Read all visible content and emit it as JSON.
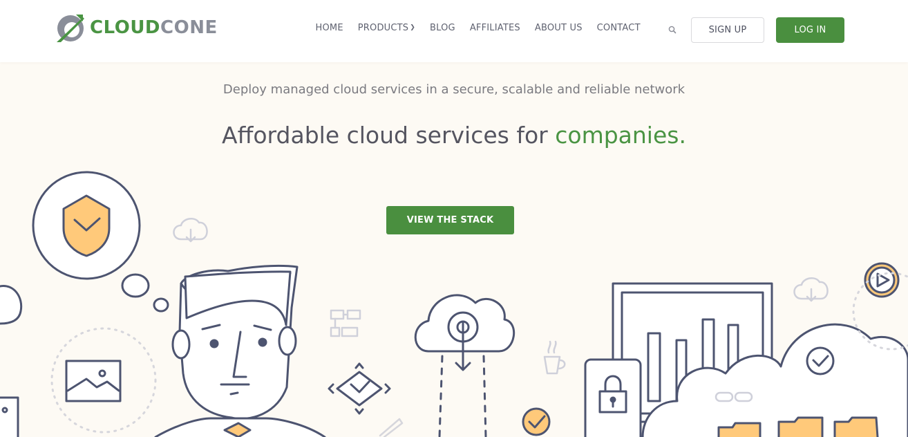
{
  "brand": {
    "part1": "CLOUD",
    "part2": "CONE",
    "accent": "#4a9443"
  },
  "nav": {
    "items": [
      {
        "label": "HOME"
      },
      {
        "label": "PRODUCTS",
        "has_dropdown": true
      },
      {
        "label": "BLOG"
      },
      {
        "label": "AFFILIATES"
      },
      {
        "label": "ABOUT US"
      },
      {
        "label": "CONTACT"
      }
    ],
    "search_icon": "search-icon",
    "signup_label": "SIGN UP",
    "login_label": "LOG IN"
  },
  "hero": {
    "subtitle": "Deploy managed cloud services in a secure, scalable and reliable network",
    "headline_prefix": "Affordable cloud services for ",
    "headline_accent": "companies.",
    "cta_label": "VIEW THE STACK"
  },
  "colors": {
    "primary_green": "#4a8f3f",
    "background": "#fdfaf4",
    "outline": "#4d5470",
    "highlight_orange": "#ffc97a"
  }
}
